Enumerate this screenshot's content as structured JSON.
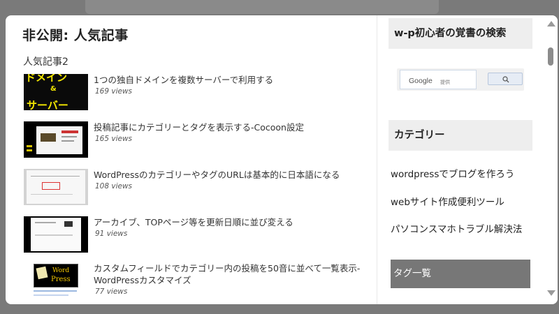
{
  "page": {
    "title": "非公開: 人気記事",
    "widget_title": "人気記事2"
  },
  "posts": [
    {
      "title": "1つの独自ドメインを複数サーバーで利用する",
      "views": "169 views"
    },
    {
      "title": "投稿記事にカテゴリーとタグを表示する-Cocoon設定",
      "views": "165 views"
    },
    {
      "title": "WordPressのカテゴリーやタグのURLは基本的に日本語になる",
      "views": "108 views"
    },
    {
      "title": "アーカイブ、TOPページ等を更新日順に並び変える",
      "views": "91 views"
    },
    {
      "title_line1": "カスタムフィールドでカテゴリー内の投稿を50音に並べて一覧表示-",
      "title_line2": "WordPressカスタマイズ",
      "views": "77 views"
    }
  ],
  "thumbs": {
    "t1": {
      "line1": "ドメイン",
      "line2": "&",
      "line3": "サーバー"
    },
    "t5": {
      "line1": "Word",
      "line2": "Press"
    }
  },
  "sidebar": {
    "search_heading": "w-p初心者の覚書の検索",
    "search": {
      "brand": "Google",
      "keyword_label": "提供"
    },
    "category_heading": "カテゴリー",
    "categories": [
      "wordpressでブログを作ろう",
      "webサイト作成便利ツール",
      "パソコンスマホトラブル解決法"
    ],
    "tag_heading": "タグ一覧"
  },
  "icons": {
    "search": "magnifier-icon",
    "scroll_up": "triangle-up-icon",
    "scroll_down": "triangle-down-icon"
  },
  "colors": {
    "window_bg": "#7a7a7a",
    "sidebar_heading_bg": "#eeeeee",
    "tag_heading_bg": "#777777",
    "thumb_yellow": "#f2e600"
  }
}
